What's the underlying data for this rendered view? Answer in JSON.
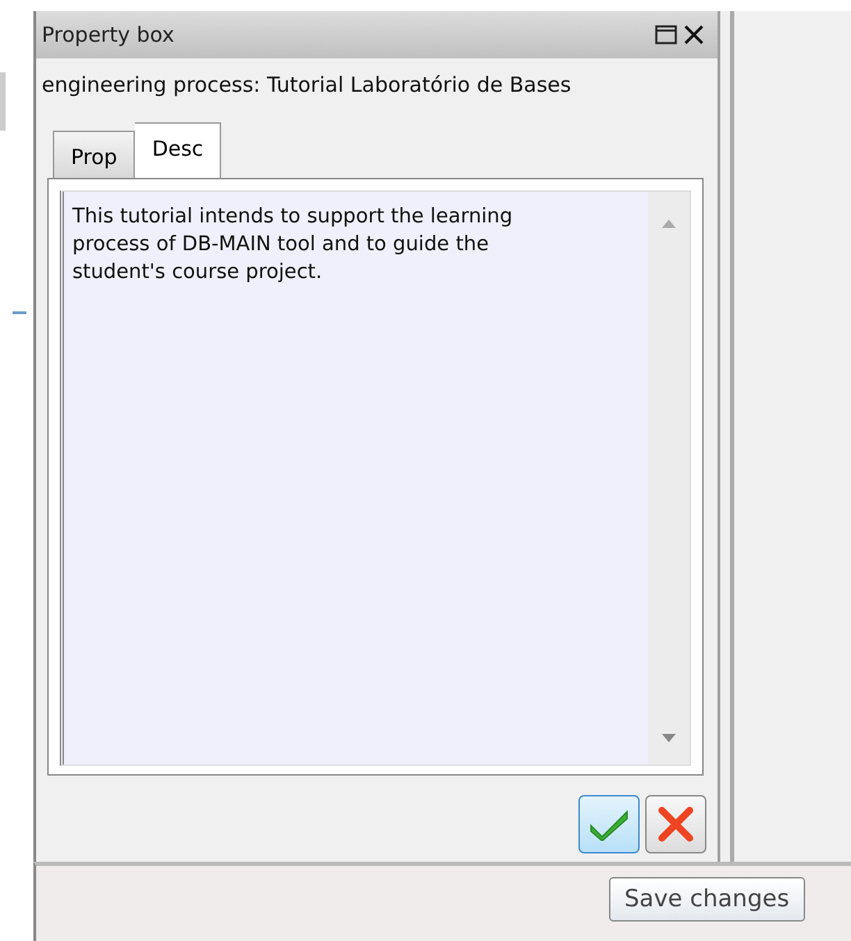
{
  "panel": {
    "title": "Property box",
    "subtitle": "engineering process: Tutorial Laboratório de Bases",
    "tabs": [
      {
        "label": "Prop",
        "selected": false
      },
      {
        "label": "Desc",
        "selected": true
      }
    ],
    "description": "This tutorial intends to support the learning process of DB-MAIN tool and to guide the student's course project."
  },
  "tooltip": "Save changes"
}
